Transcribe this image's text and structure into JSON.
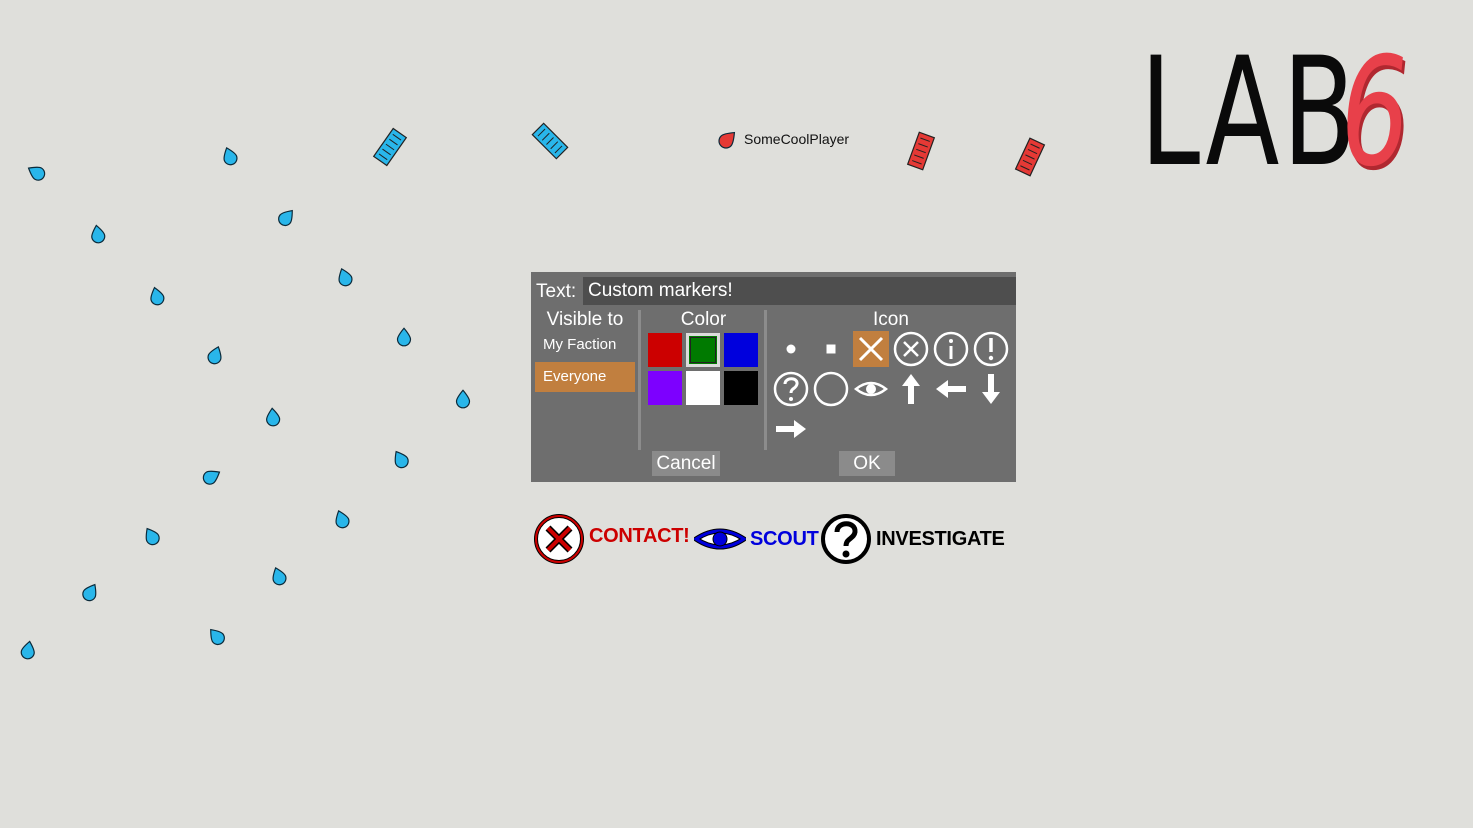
{
  "logo": {
    "lab": "LAB",
    "six": "6"
  },
  "player": {
    "name": "SomeCoolPlayer"
  },
  "dialog": {
    "text_label": "Text:",
    "text_value": "Custom markers!",
    "visible_to": {
      "title": "Visible to",
      "options": [
        "My Faction",
        "Everyone"
      ],
      "selected": "Everyone"
    },
    "color": {
      "title": "Color",
      "swatches": [
        "#cc0000",
        "#007a00",
        "#0000dd",
        "#7d00ff",
        "#ffffff",
        "#000000"
      ],
      "selected": "#007a00"
    },
    "icon": {
      "title": "Icon",
      "options": [
        "dot",
        "square",
        "cross",
        "circle-x",
        "info",
        "exclamation",
        "question",
        "circle",
        "eye",
        "arrow-up",
        "arrow-left",
        "arrow-down",
        "arrow-right"
      ],
      "selected": "cross"
    },
    "cancel_label": "Cancel",
    "ok_label": "OK"
  },
  "examples": [
    {
      "label": "CONTACT!",
      "icon": "circle-x",
      "color": "#cc0000"
    },
    {
      "label": "SCOUT",
      "icon": "eye",
      "color": "#0000dd"
    },
    {
      "label": "INVESTIGATE",
      "icon": "question",
      "color": "#000000"
    }
  ],
  "colors": {
    "background": "#dfdfdb",
    "friendly_unit": "#29b6ea",
    "enemy_unit": "#e53935",
    "selection_accent": "#c17f3f",
    "dialog_bg": "#6e6e6e"
  }
}
